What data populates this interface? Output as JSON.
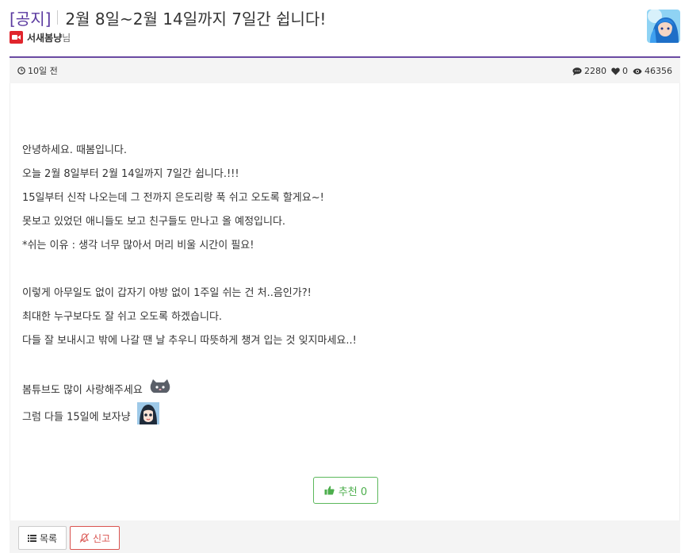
{
  "post": {
    "notice_tag": "[공지]",
    "title": "2월 8일~2월 14일까지 7일간 쉽니다!",
    "author": "서새봄냥",
    "author_suffix": "님"
  },
  "meta": {
    "time_ago": "10일 전",
    "comments": "2280",
    "likes": "0",
    "views": "46356"
  },
  "body": {
    "lines": [
      "안녕하세요. 때봄입니다.",
      "오늘 2월 8일부터 2월 14일까지 7일간 쉽니다.!!!",
      "15일부터 신작 나오는데 그 전까지 은도리랑 푹 쉬고 오도록 할게요~!",
      "못보고 있었던 애니들도 보고 친구들도 만나고 올 예정입니다.",
      "*쉬는 이유 : 생각 너무 많아서 머리 비울 시간이 필요!",
      "",
      "이렇게 아무일도 없이 갑자기 야방 없이 1주일 쉬는 건 처..음인가?!",
      "최대한 누구보다도 잘 쉬고 오도록 하겠습니다.",
      "다들 잘 보내시고 밖에 나갈 땐 날 추우니 따뜻하게 챙겨 입는 것 잊지마세요..!",
      "",
      "봄튜브도 많이 사랑해주세요",
      "그럼 다들 15일에 보자냥"
    ]
  },
  "actions": {
    "recommend_label": "추천 0",
    "list_label": "목록",
    "report_label": "신고"
  },
  "colors": {
    "accent": "#6a4aa2",
    "recommend": "#5cb85c",
    "report": "#d9534f"
  }
}
